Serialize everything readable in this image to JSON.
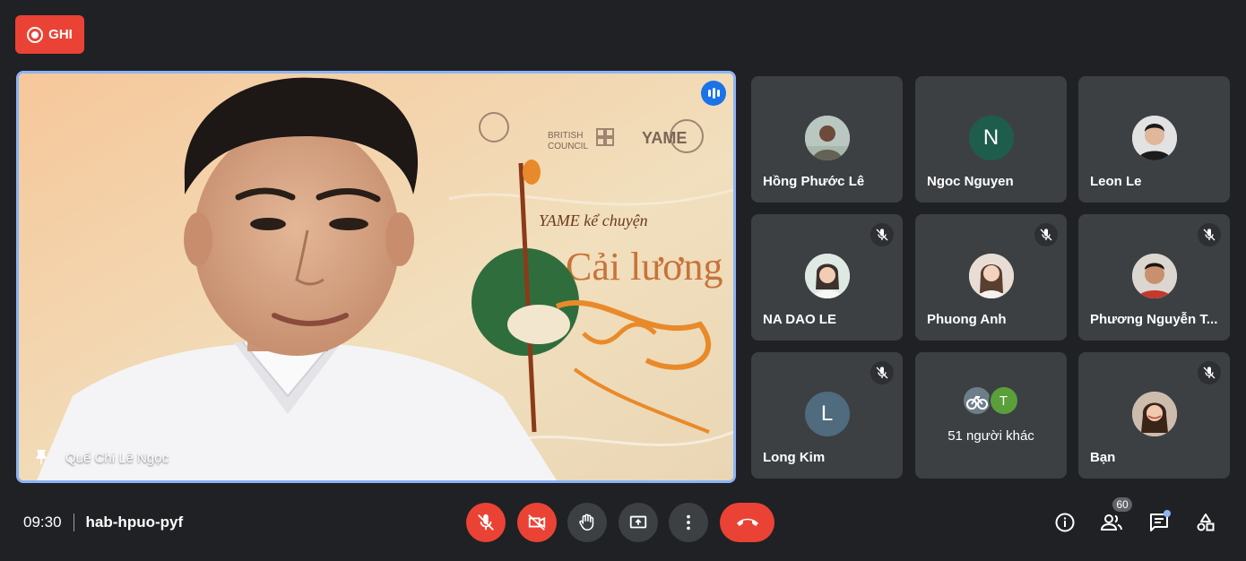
{
  "recording": {
    "label": "GHI",
    "color": "#ea4335"
  },
  "main_speaker": {
    "name": "Quế Chi Lê Ngọc",
    "is_speaking": true,
    "pinned": true
  },
  "participants": [
    {
      "name": "Hồng Phước Lê",
      "avatar_type": "photo",
      "muted": false
    },
    {
      "name": "Ngoc Nguyen",
      "avatar_type": "initial",
      "initial": "N",
      "avatar_color": "#1e5d4c",
      "muted": false
    },
    {
      "name": "Leon Le",
      "avatar_type": "photo",
      "muted": false
    },
    {
      "name": "NA DAO LE",
      "avatar_type": "photo",
      "muted": true
    },
    {
      "name": "Phuong Anh",
      "avatar_type": "photo",
      "muted": true
    },
    {
      "name": "Phương Nguyễn T...",
      "avatar_type": "photo",
      "muted": true
    },
    {
      "name": "Long Kim",
      "avatar_type": "initial",
      "initial": "L",
      "avatar_color": "#4f6b7d",
      "muted": true
    },
    {
      "name": "51 người khác",
      "avatar_type": "others",
      "initial": "T",
      "avatar_color": "#5a9f3a"
    },
    {
      "name": "Bạn",
      "avatar_type": "photo",
      "muted": true
    }
  ],
  "meeting": {
    "time": "09:30",
    "code": "hab-hpuo-pyf"
  },
  "controls": [
    {
      "name": "microphone-off",
      "icon": "mic-off-icon",
      "state": "off"
    },
    {
      "name": "camera-off",
      "icon": "camera-off-icon",
      "state": "off"
    },
    {
      "name": "raise-hand",
      "icon": "hand-icon"
    },
    {
      "name": "present-screen",
      "icon": "present-icon"
    },
    {
      "name": "more-options",
      "icon": "more-vert-icon"
    },
    {
      "name": "leave-call",
      "icon": "call-end-icon"
    }
  ],
  "right_controls": {
    "people_count": "60",
    "icons": [
      "info-icon",
      "people-icon",
      "chat-icon",
      "activities-icon"
    ]
  },
  "colors": {
    "background": "#202124",
    "tile": "#3c4043",
    "danger": "#ea4335",
    "accent": "#8ab4f8",
    "speaking": "#1a73e8"
  }
}
